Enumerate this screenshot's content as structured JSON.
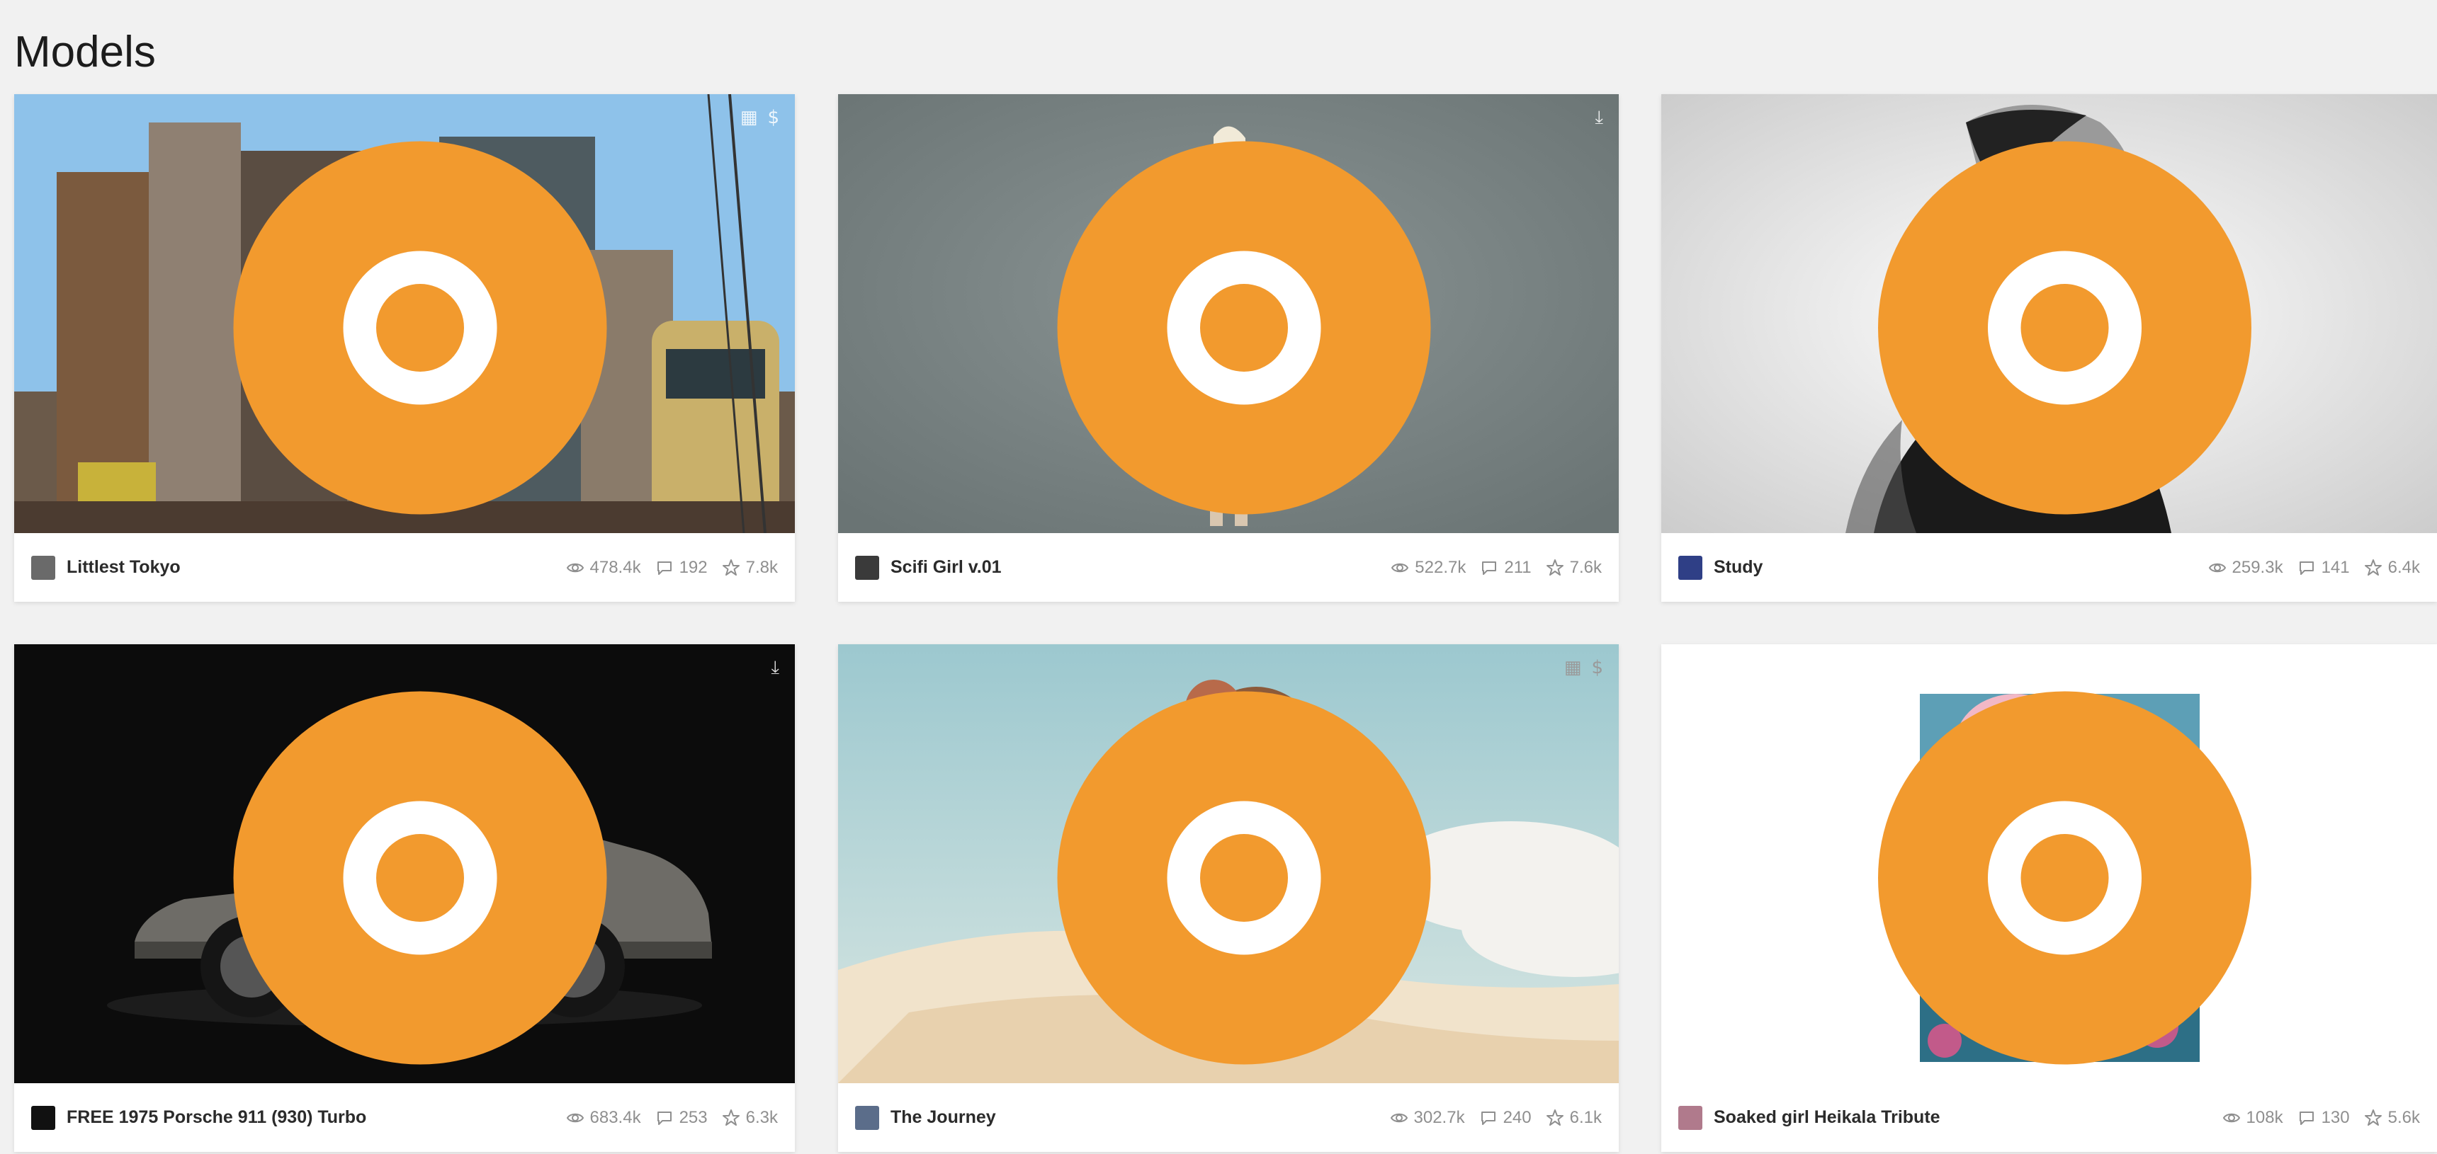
{
  "page": {
    "title": "Models"
  },
  "colors": {
    "background": "#f1f1f1",
    "staff_pick": "#f29a2e",
    "meta_text": "#8f8f8f",
    "title_text": "#2b2b2b"
  },
  "cards": [
    {
      "title": "Littlest Tokyo",
      "views": "478.4k",
      "comments": "192",
      "likes": "7.8k",
      "corner_icons": [
        "store-icon",
        "price-icon"
      ],
      "avatar_color": "#6a6a6a",
      "thumb": "diorama-street"
    },
    {
      "title": "Scifi Girl v.01",
      "views": "522.7k",
      "comments": "211",
      "likes": "7.6k",
      "corner_icons": [
        "download-icon"
      ],
      "avatar_color": "#3a3a3a",
      "thumb": "scifi-girl"
    },
    {
      "title": "Study",
      "views": "259.3k",
      "comments": "141",
      "likes": "6.4k",
      "corner_icons": [],
      "avatar_color": "#2f3f86",
      "thumb": "portrait-sketch"
    },
    {
      "title": "FREE 1975 Porsche 911 (930) Turbo",
      "views": "683.4k",
      "comments": "253",
      "likes": "6.3k",
      "corner_icons": [
        "download-icon"
      ],
      "avatar_color": "#111111",
      "thumb": "porsche"
    },
    {
      "title": "The Journey",
      "views": "302.7k",
      "comments": "240",
      "likes": "6.1k",
      "corner_icons": [
        "store-icon",
        "price-icon"
      ],
      "avatar_color": "#5b6d8a",
      "thumb": "journey"
    },
    {
      "title": "Soaked girl Heikala Tribute",
      "views": "108k",
      "comments": "130",
      "likes": "5.6k",
      "corner_icons": [],
      "avatar_color": "#b07a8c",
      "thumb": "soaked-girl"
    }
  ]
}
